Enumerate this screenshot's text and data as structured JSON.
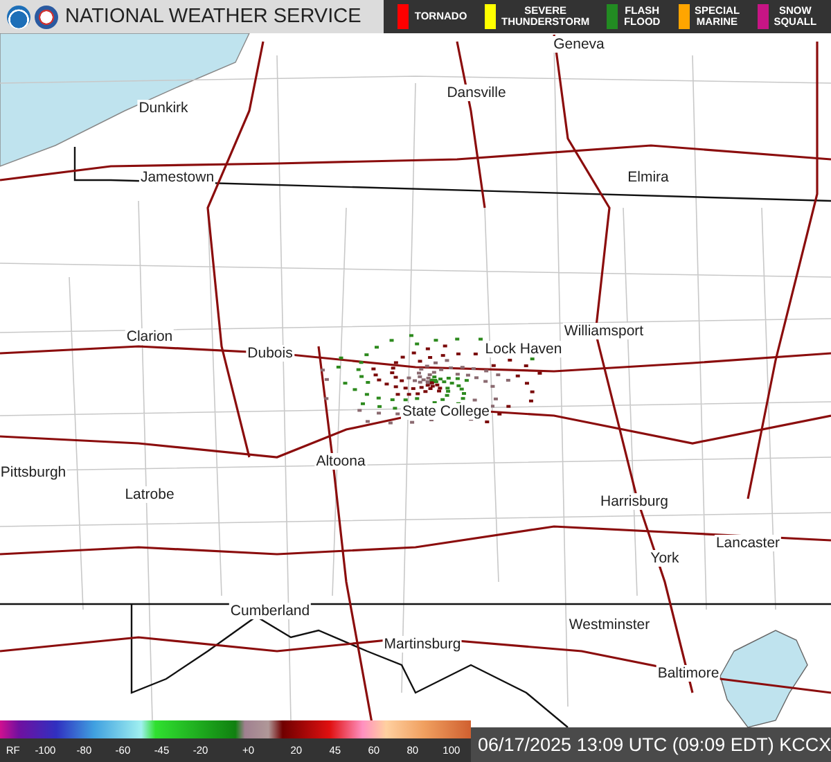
{
  "header": {
    "title": "NATIONAL WEATHER SERVICE"
  },
  "warnings": [
    {
      "label": "TORNADO",
      "color": "#ff0000"
    },
    {
      "label": "SEVERE THUNDERSTORM",
      "color": "#ffff00"
    },
    {
      "label": "FLASH FLOOD",
      "color": "#228b22"
    },
    {
      "label": "SPECIAL MARINE",
      "color": "#ffa500"
    },
    {
      "label": "SNOW SQUALL",
      "color": "#c71585"
    }
  ],
  "map": {
    "cities": [
      "Geneva",
      "Dansville",
      "Dunkirk",
      "Jamestown",
      "Elmira",
      "Clarion",
      "Williamsport",
      "Dubois",
      "Lock Haven",
      "State College",
      "Altoona",
      "Pittsburgh",
      "Latrobe",
      "Harrisburg",
      "Lancaster",
      "York",
      "Cumberland",
      "Westminster",
      "Martinsburg",
      "Baltimore"
    ]
  },
  "color_scale": {
    "ticks": [
      "RF",
      "-100",
      "-80",
      "-60",
      "-45",
      "-20",
      "+0",
      "20",
      "45",
      "60",
      "80",
      "100"
    ]
  },
  "timestamp": "06/17/2025 13:09 UTC (09:09 EDT) KCCX"
}
